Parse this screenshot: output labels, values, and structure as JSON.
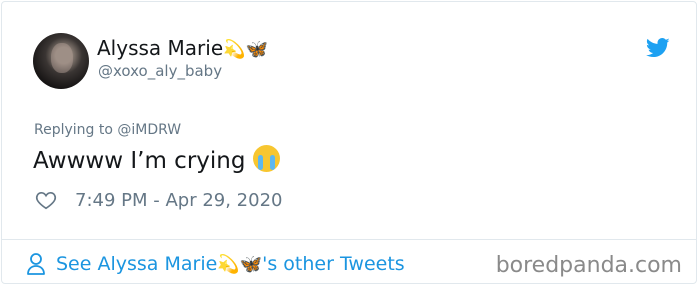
{
  "user": {
    "display_name": "Alyssa Marie",
    "name_emojis": [
      "dizzy-emoji",
      "butterfly-emoji"
    ],
    "handle": "@xoxo_aly_baby"
  },
  "tweet": {
    "replying_to": "Replying to @iMDRW",
    "text": "Awwww I’m crying",
    "text_emoji": "loudly-crying-face-emoji",
    "timestamp": "7:49 PM - Apr 29, 2020"
  },
  "footer": {
    "see_prefix": "See Alyssa Marie",
    "see_suffix": "'s other Tweets",
    "watermark": "boredpanda.com"
  },
  "icons": {
    "brand": "twitter-bird-icon",
    "like": "heart-icon",
    "profile": "person-icon"
  },
  "colors": {
    "twitter_blue": "#1da1f2",
    "link_blue": "#1b95e0",
    "muted_text": "#657786",
    "primary_text": "#14171a",
    "border": "#e1e8ed"
  }
}
